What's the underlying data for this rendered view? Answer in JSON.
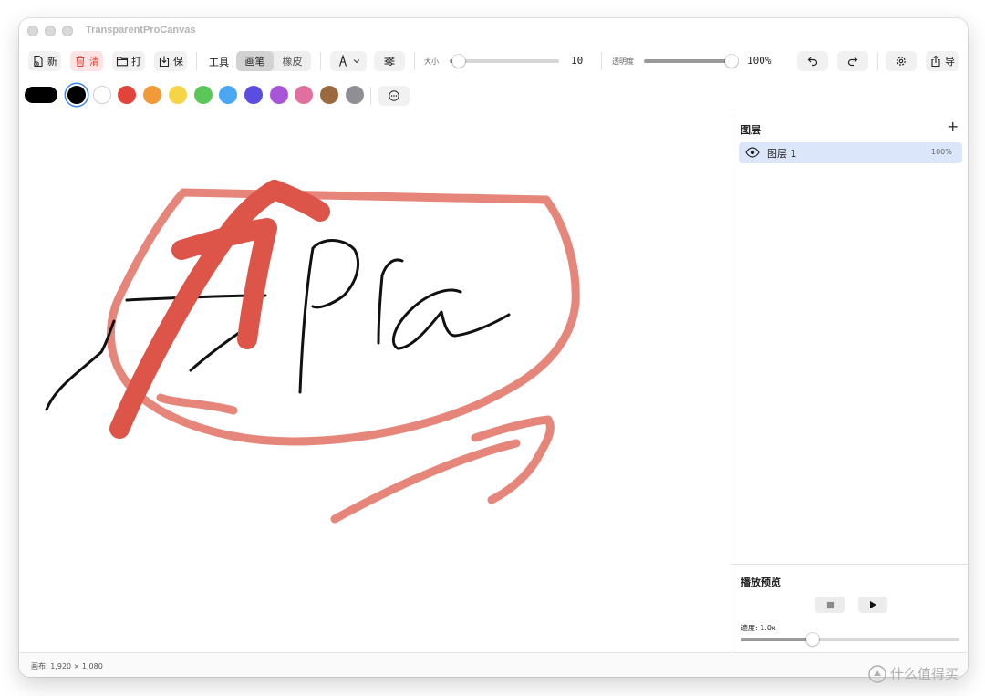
{
  "window": {
    "title": "TransparentProCanvas"
  },
  "toolbar": {
    "new_label": "新",
    "clear_label": "清",
    "open_label": "打",
    "save_label": "保",
    "tool_label": "工具",
    "pen_tab": "画笔",
    "eraser_tab": "橡皮",
    "size_label": "大小",
    "size_value": "10",
    "size_level": 0.08,
    "opacity_label": "透明度",
    "opacity_value": "100%",
    "opacity_level": 1.0,
    "share_label": "导"
  },
  "colors": {
    "current": "#000000",
    "palette": [
      "#000000",
      "#ffffff",
      "#e0443b",
      "#f29a38",
      "#f5d547",
      "#5cc759",
      "#4aa8f2",
      "#5a4de0",
      "#a955d9",
      "#e2709e",
      "#9a6a3d",
      "#8e8e93"
    ]
  },
  "layers": {
    "title": "图层",
    "add_label": "+",
    "items": [
      {
        "name": "图层 1",
        "opacity": "100%"
      }
    ]
  },
  "playback": {
    "title": "播放预览",
    "speed_label": "速度: 1.0x",
    "speed_level": 0.33
  },
  "status": {
    "canvas_size": "画布: 1,920 × 1,080"
  },
  "watermark": {
    "text": "什么值得买"
  }
}
